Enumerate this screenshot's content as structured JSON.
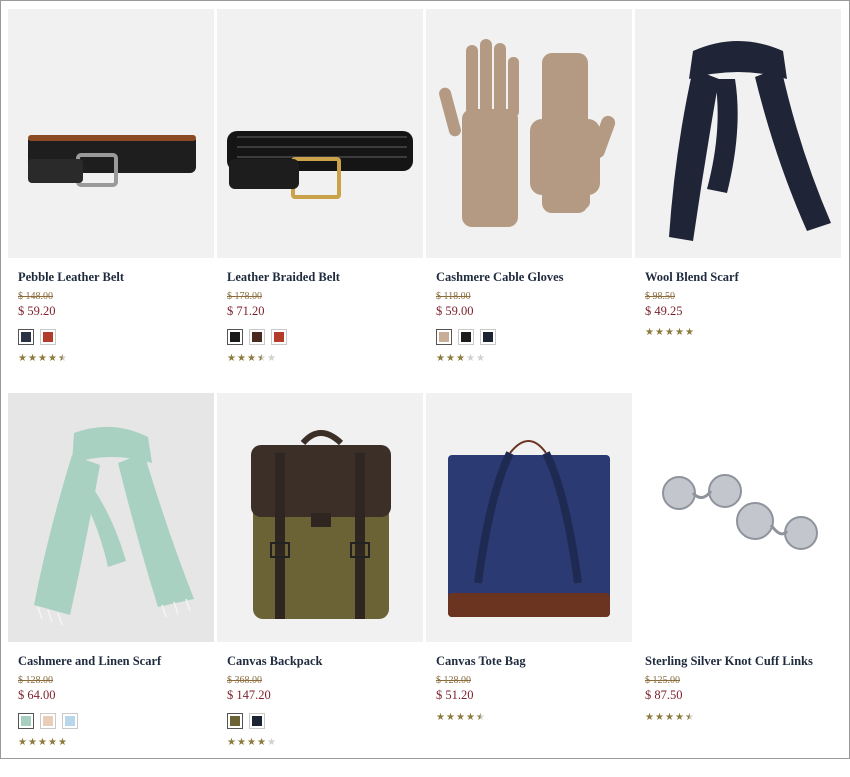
{
  "products": [
    {
      "name": "Pebble Leather Belt",
      "old_price": "$ 148.00",
      "price": "$ 59.20",
      "icon": "belt-icon",
      "swatches": [
        "#2a3346",
        "#b33b2a"
      ],
      "rating": 4.5
    },
    {
      "name": "Leather Braided Belt",
      "old_price": "$ 178.00",
      "price": "$ 71.20",
      "icon": "braided-belt-icon",
      "swatches": [
        "#1a1a1a",
        "#4a2a1e",
        "#b33b2a"
      ],
      "rating": 3.5
    },
    {
      "name": "Cashmere Cable Gloves",
      "old_price": "$ 118.00",
      "price": "$ 59.00",
      "icon": "gloves-icon",
      "swatches": [
        "#c8ad97",
        "#1b1b1b",
        "#1c2333"
      ],
      "rating": 3
    },
    {
      "name": "Wool Blend Scarf",
      "old_price": "$ 98.50",
      "price": "$ 49.25",
      "icon": "scarf-icon",
      "swatches": [],
      "rating": 5
    },
    {
      "name": "Cashmere and Linen Scarf",
      "old_price": "$ 128.00",
      "price": "$ 64.00",
      "icon": "scarf-icon",
      "swatches": [
        "#a6cfc0",
        "#e9cdb9",
        "#b9d7ea"
      ],
      "rating": 5
    },
    {
      "name": "Canvas Backpack",
      "old_price": "$ 368.00",
      "price": "$ 147.20",
      "icon": "backpack-icon",
      "swatches": [
        "#6b6236",
        "#1c2333"
      ],
      "rating": 4
    },
    {
      "name": "Canvas Tote Bag",
      "old_price": "$ 128.00",
      "price": "$ 51.20",
      "icon": "tote-bag-icon",
      "swatches": [],
      "rating": 4.5
    },
    {
      "name": "Sterling Silver Knot Cuff Links",
      "old_price": "$ 125.00",
      "price": "$ 87.50",
      "icon": "cufflinks-icon",
      "swatches": [],
      "rating": 4.5
    }
  ]
}
